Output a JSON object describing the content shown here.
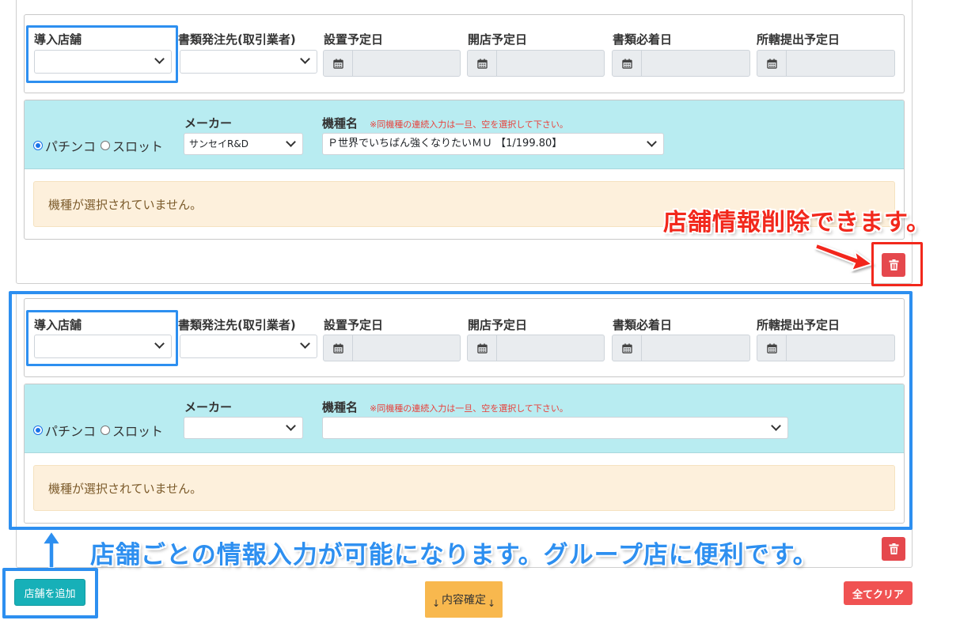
{
  "labels": {
    "store": "導入店舗",
    "supplier": "書類発注先(取引業者)",
    "install_date": "設置予定日",
    "open_date": "開店予定日",
    "doc_arrival": "書類必着日",
    "submit_date": "所轄提出予定日",
    "maker": "メーカー",
    "model": "機種名",
    "model_note": "※同機種の連続入力は一旦、空を選択して下さい。",
    "radio_pachinko": "パチンコ",
    "radio_slot": "スロット",
    "no_model": "機種が選択されていません。"
  },
  "store1": {
    "store_value": "",
    "supplier_value": "",
    "maker_value": "サンセイR&D",
    "model_value": "Ｐ世界でいちばん強くなりたいＭＵ 【1/199.80】",
    "selected_type": "pachinko"
  },
  "store2": {
    "store_value": "",
    "supplier_value": "",
    "maker_value": "",
    "model_value": "",
    "selected_type": "pachinko"
  },
  "annotations": {
    "delete_note": "店舗情報削除できます。",
    "per_store_note": "店舗ごとの情報入力が可能になります。グループ店に便利です。"
  },
  "buttons": {
    "add_store": "店舗を追加",
    "confirm": "内容確定",
    "clear_all": "全てクリア"
  },
  "icons": {
    "calendar": "calendar-icon",
    "trash": "trash-icon",
    "chevron": "chevron-down-icon"
  },
  "colors": {
    "accent_blue": "#2d8ff0",
    "accent_red": "#f2281c",
    "machine_header": "#b8ecf1",
    "warning_bg": "#fdf0dc"
  }
}
